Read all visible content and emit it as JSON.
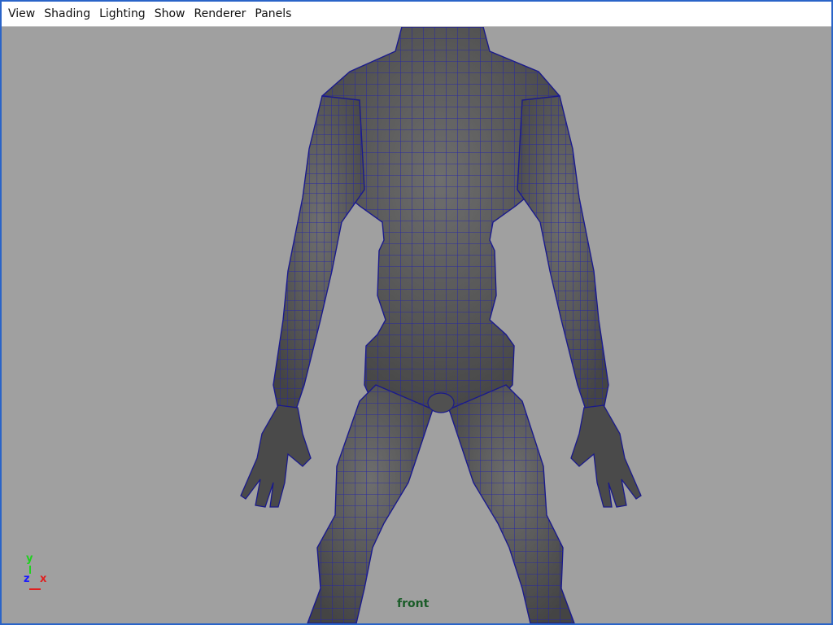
{
  "menubar": {
    "items": [
      {
        "label": "View"
      },
      {
        "label": "Shading"
      },
      {
        "label": "Lighting"
      },
      {
        "label": "Show"
      },
      {
        "label": "Renderer"
      },
      {
        "label": "Panels"
      }
    ]
  },
  "viewport": {
    "camera": "front",
    "axis": {
      "y": "y",
      "z": "z",
      "x": "x"
    },
    "background_color": "#a0a0a0",
    "wireframe_color": "#2020b0",
    "mesh_color": "#5a5a5a"
  }
}
